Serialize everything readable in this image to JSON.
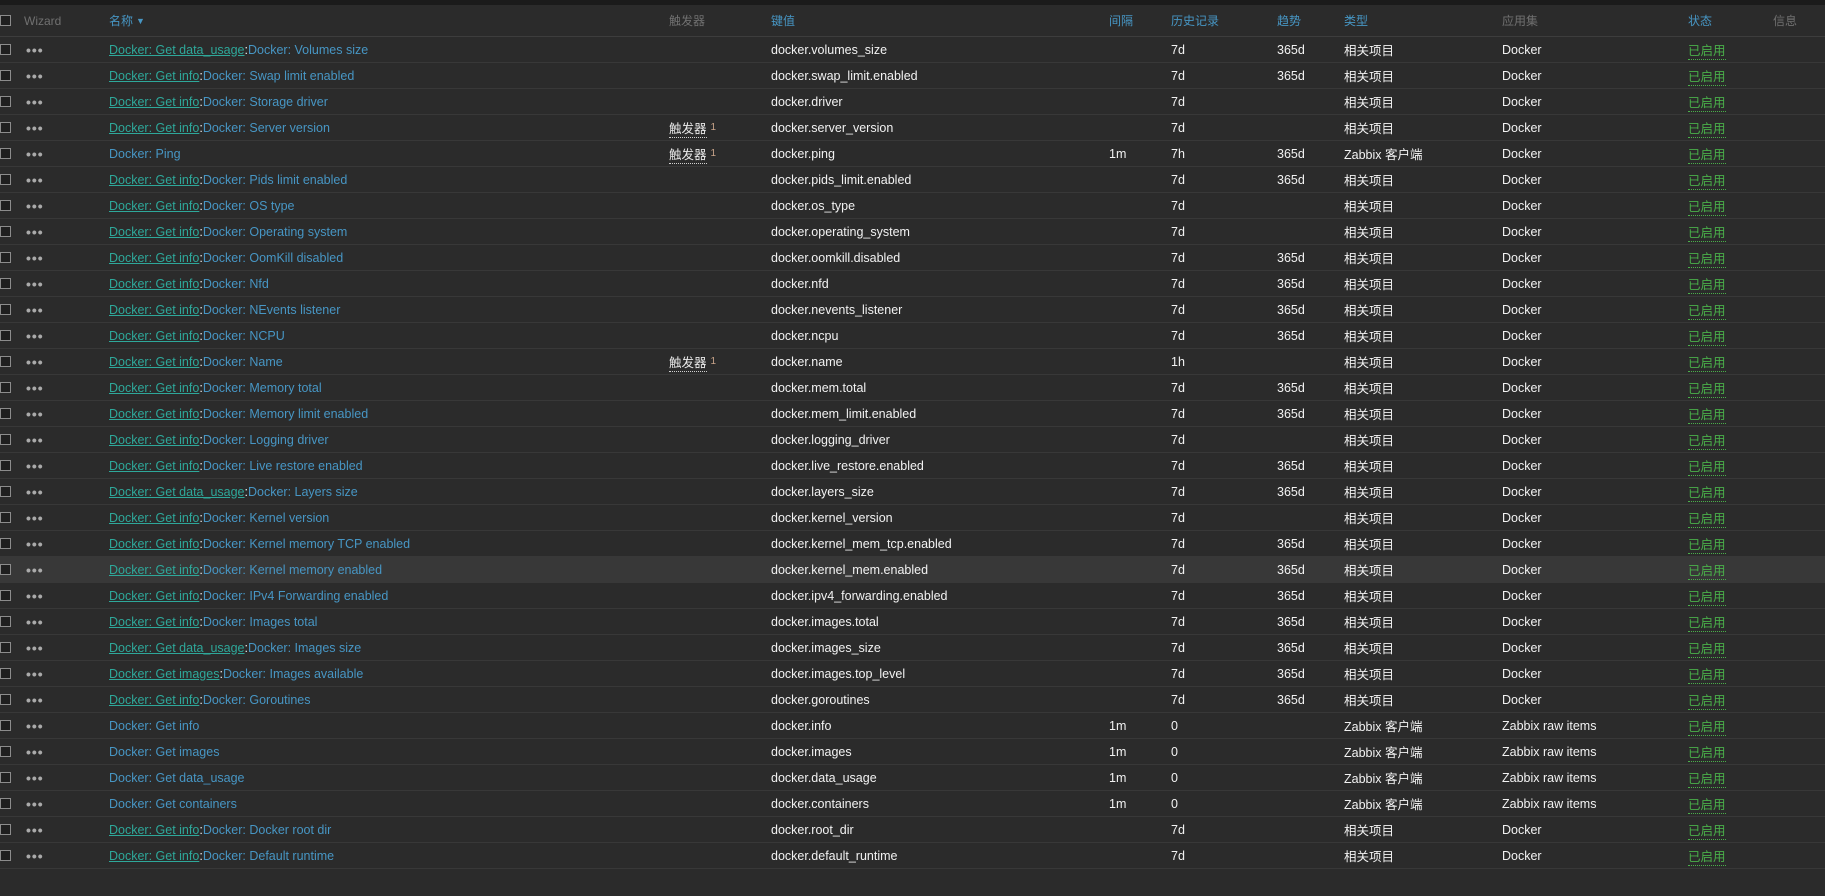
{
  "header": {
    "wizard": "Wizard",
    "name": "名称",
    "sort_arrow": "▼",
    "triggers": "触发器",
    "key": "键值",
    "interval": "间隔",
    "history": "历史记录",
    "trends": "趋势",
    "type": "类型",
    "app": "应用集",
    "status": "状态",
    "info": "信息"
  },
  "colors": {
    "background": "#2b2b2b",
    "link": "#4796c4",
    "prefix_link": "#2ea89a",
    "status_enabled": "#4ab04a"
  },
  "rows": [
    {
      "prefix": "Docker: Get data_usage",
      "name": "Docker: Volumes size",
      "triggers": "",
      "trig_count": "",
      "key": "docker.volumes_size",
      "interval": "",
      "history": "7d",
      "trends": "365d",
      "type": "相关项目",
      "app": "Docker",
      "status": "已启用"
    },
    {
      "prefix": "Docker: Get info",
      "name": "Docker: Swap limit enabled",
      "triggers": "",
      "trig_count": "",
      "key": "docker.swap_limit.enabled",
      "interval": "",
      "history": "7d",
      "trends": "365d",
      "type": "相关项目",
      "app": "Docker",
      "status": "已启用"
    },
    {
      "prefix": "Docker: Get info",
      "name": "Docker: Storage driver",
      "triggers": "",
      "trig_count": "",
      "key": "docker.driver",
      "interval": "",
      "history": "7d",
      "trends": "",
      "type": "相关项目",
      "app": "Docker",
      "status": "已启用"
    },
    {
      "prefix": "Docker: Get info",
      "name": "Docker: Server version",
      "triggers": "触发器",
      "trig_count": "1",
      "key": "docker.server_version",
      "interval": "",
      "history": "7d",
      "trends": "",
      "type": "相关项目",
      "app": "Docker",
      "status": "已启用"
    },
    {
      "prefix": "",
      "name": "Docker: Ping",
      "triggers": "触发器",
      "trig_count": "1",
      "key": "docker.ping",
      "interval": "1m",
      "history": "7h",
      "trends": "365d",
      "type": "Zabbix 客户端",
      "app": "Docker",
      "status": "已启用"
    },
    {
      "prefix": "Docker: Get info",
      "name": "Docker: Pids limit enabled",
      "triggers": "",
      "trig_count": "",
      "key": "docker.pids_limit.enabled",
      "interval": "",
      "history": "7d",
      "trends": "365d",
      "type": "相关项目",
      "app": "Docker",
      "status": "已启用"
    },
    {
      "prefix": "Docker: Get info",
      "name": "Docker: OS type",
      "triggers": "",
      "trig_count": "",
      "key": "docker.os_type",
      "interval": "",
      "history": "7d",
      "trends": "",
      "type": "相关项目",
      "app": "Docker",
      "status": "已启用"
    },
    {
      "prefix": "Docker: Get info",
      "name": "Docker: Operating system",
      "triggers": "",
      "trig_count": "",
      "key": "docker.operating_system",
      "interval": "",
      "history": "7d",
      "trends": "",
      "type": "相关项目",
      "app": "Docker",
      "status": "已启用"
    },
    {
      "prefix": "Docker: Get info",
      "name": "Docker: OomKill disabled",
      "triggers": "",
      "trig_count": "",
      "key": "docker.oomkill.disabled",
      "interval": "",
      "history": "7d",
      "trends": "365d",
      "type": "相关项目",
      "app": "Docker",
      "status": "已启用"
    },
    {
      "prefix": "Docker: Get info",
      "name": "Docker: Nfd",
      "triggers": "",
      "trig_count": "",
      "key": "docker.nfd",
      "interval": "",
      "history": "7d",
      "trends": "365d",
      "type": "相关项目",
      "app": "Docker",
      "status": "已启用"
    },
    {
      "prefix": "Docker: Get info",
      "name": "Docker: NEvents listener",
      "triggers": "",
      "trig_count": "",
      "key": "docker.nevents_listener",
      "interval": "",
      "history": "7d",
      "trends": "365d",
      "type": "相关项目",
      "app": "Docker",
      "status": "已启用"
    },
    {
      "prefix": "Docker: Get info",
      "name": "Docker: NCPU",
      "triggers": "",
      "trig_count": "",
      "key": "docker.ncpu",
      "interval": "",
      "history": "7d",
      "trends": "365d",
      "type": "相关项目",
      "app": "Docker",
      "status": "已启用"
    },
    {
      "prefix": "Docker: Get info",
      "name": "Docker: Name",
      "triggers": "触发器",
      "trig_count": "1",
      "key": "docker.name",
      "interval": "",
      "history": "1h",
      "trends": "",
      "type": "相关项目",
      "app": "Docker",
      "status": "已启用"
    },
    {
      "prefix": "Docker: Get info",
      "name": "Docker: Memory total",
      "triggers": "",
      "trig_count": "",
      "key": "docker.mem.total",
      "interval": "",
      "history": "7d",
      "trends": "365d",
      "type": "相关项目",
      "app": "Docker",
      "status": "已启用"
    },
    {
      "prefix": "Docker: Get info",
      "name": "Docker: Memory limit enabled",
      "triggers": "",
      "trig_count": "",
      "key": "docker.mem_limit.enabled",
      "interval": "",
      "history": "7d",
      "trends": "365d",
      "type": "相关项目",
      "app": "Docker",
      "status": "已启用"
    },
    {
      "prefix": "Docker: Get info",
      "name": "Docker: Logging driver",
      "triggers": "",
      "trig_count": "",
      "key": "docker.logging_driver",
      "interval": "",
      "history": "7d",
      "trends": "",
      "type": "相关项目",
      "app": "Docker",
      "status": "已启用"
    },
    {
      "prefix": "Docker: Get info",
      "name": "Docker: Live restore enabled",
      "triggers": "",
      "trig_count": "",
      "key": "docker.live_restore.enabled",
      "interval": "",
      "history": "7d",
      "trends": "365d",
      "type": "相关项目",
      "app": "Docker",
      "status": "已启用"
    },
    {
      "prefix": "Docker: Get data_usage",
      "name": "Docker: Layers size",
      "triggers": "",
      "trig_count": "",
      "key": "docker.layers_size",
      "interval": "",
      "history": "7d",
      "trends": "365d",
      "type": "相关项目",
      "app": "Docker",
      "status": "已启用"
    },
    {
      "prefix": "Docker: Get info",
      "name": "Docker: Kernel version",
      "triggers": "",
      "trig_count": "",
      "key": "docker.kernel_version",
      "interval": "",
      "history": "7d",
      "trends": "",
      "type": "相关项目",
      "app": "Docker",
      "status": "已启用"
    },
    {
      "prefix": "Docker: Get info",
      "name": "Docker: Kernel memory TCP enabled",
      "triggers": "",
      "trig_count": "",
      "key": "docker.kernel_mem_tcp.enabled",
      "interval": "",
      "history": "7d",
      "trends": "365d",
      "type": "相关项目",
      "app": "Docker",
      "status": "已启用"
    },
    {
      "prefix": "Docker: Get info",
      "name": "Docker: Kernel memory enabled",
      "triggers": "",
      "trig_count": "",
      "key": "docker.kernel_mem.enabled",
      "interval": "",
      "history": "7d",
      "trends": "365d",
      "type": "相关项目",
      "app": "Docker",
      "status": "已启用",
      "highlight": true
    },
    {
      "prefix": "Docker: Get info",
      "name": "Docker: IPv4 Forwarding enabled",
      "triggers": "",
      "trig_count": "",
      "key": "docker.ipv4_forwarding.enabled",
      "interval": "",
      "history": "7d",
      "trends": "365d",
      "type": "相关项目",
      "app": "Docker",
      "status": "已启用"
    },
    {
      "prefix": "Docker: Get info",
      "name": "Docker: Images total",
      "triggers": "",
      "trig_count": "",
      "key": "docker.images.total",
      "interval": "",
      "history": "7d",
      "trends": "365d",
      "type": "相关项目",
      "app": "Docker",
      "status": "已启用"
    },
    {
      "prefix": "Docker: Get data_usage",
      "name": "Docker: Images size",
      "triggers": "",
      "trig_count": "",
      "key": "docker.images_size",
      "interval": "",
      "history": "7d",
      "trends": "365d",
      "type": "相关项目",
      "app": "Docker",
      "status": "已启用"
    },
    {
      "prefix": "Docker: Get images",
      "name": "Docker: Images available",
      "triggers": "",
      "trig_count": "",
      "key": "docker.images.top_level",
      "interval": "",
      "history": "7d",
      "trends": "365d",
      "type": "相关项目",
      "app": "Docker",
      "status": "已启用"
    },
    {
      "prefix": "Docker: Get info",
      "name": "Docker: Goroutines",
      "triggers": "",
      "trig_count": "",
      "key": "docker.goroutines",
      "interval": "",
      "history": "7d",
      "trends": "365d",
      "type": "相关项目",
      "app": "Docker",
      "status": "已启用"
    },
    {
      "prefix": "",
      "name": "Docker: Get info",
      "triggers": "",
      "trig_count": "",
      "key": "docker.info",
      "interval": "1m",
      "history": "0",
      "trends": "",
      "type": "Zabbix 客户端",
      "app": "Zabbix raw items",
      "status": "已启用"
    },
    {
      "prefix": "",
      "name": "Docker: Get images",
      "triggers": "",
      "trig_count": "",
      "key": "docker.images",
      "interval": "1m",
      "history": "0",
      "trends": "",
      "type": "Zabbix 客户端",
      "app": "Zabbix raw items",
      "status": "已启用"
    },
    {
      "prefix": "",
      "name": "Docker: Get data_usage",
      "triggers": "",
      "trig_count": "",
      "key": "docker.data_usage",
      "interval": "1m",
      "history": "0",
      "trends": "",
      "type": "Zabbix 客户端",
      "app": "Zabbix raw items",
      "status": "已启用"
    },
    {
      "prefix": "",
      "name": "Docker: Get containers",
      "triggers": "",
      "trig_count": "",
      "key": "docker.containers",
      "interval": "1m",
      "history": "0",
      "trends": "",
      "type": "Zabbix 客户端",
      "app": "Zabbix raw items",
      "status": "已启用"
    },
    {
      "prefix": "Docker: Get info",
      "name": "Docker: Docker root dir",
      "triggers": "",
      "trig_count": "",
      "key": "docker.root_dir",
      "interval": "",
      "history": "7d",
      "trends": "",
      "type": "相关项目",
      "app": "Docker",
      "status": "已启用"
    },
    {
      "prefix": "Docker: Get info",
      "name": "Docker: Default runtime",
      "triggers": "",
      "trig_count": "",
      "key": "docker.default_runtime",
      "interval": "",
      "history": "7d",
      "trends": "",
      "type": "相关项目",
      "app": "Docker",
      "status": "已启用"
    }
  ]
}
